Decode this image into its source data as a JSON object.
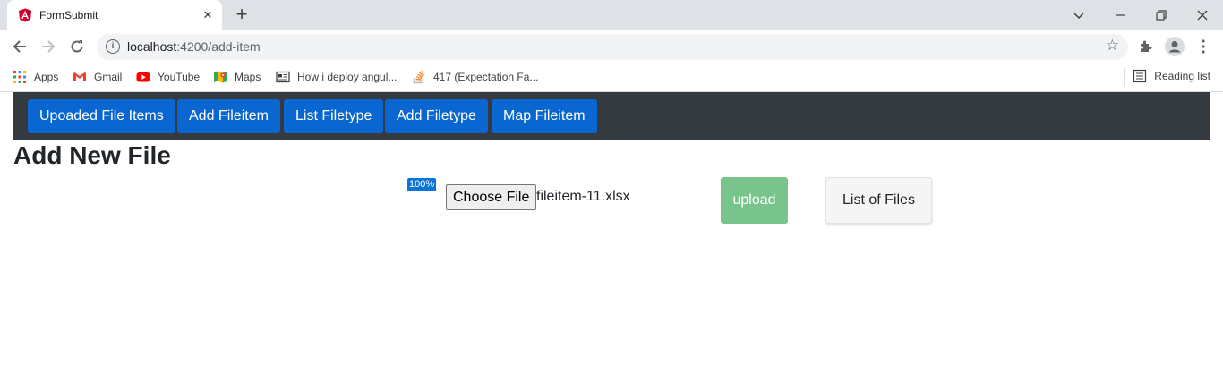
{
  "browser": {
    "tab_title": "FormSubmit",
    "tab_close": "✕",
    "new_tab": "+",
    "url_host": "localhost",
    "url_path": ":4200/add-item",
    "bookmarks": [
      {
        "label": "Apps",
        "icon": "apps-grid-icon"
      },
      {
        "label": "Gmail",
        "icon": "gmail-icon"
      },
      {
        "label": "YouTube",
        "icon": "youtube-icon"
      },
      {
        "label": "Maps",
        "icon": "maps-icon"
      },
      {
        "label": "How i deploy angul...",
        "icon": "page-icon"
      },
      {
        "label": "417 (Expectation Fa...",
        "icon": "stackoverflow-icon"
      }
    ],
    "reading_list": "Reading list"
  },
  "navbar": {
    "items": [
      "Upoaded File Items",
      "Add Fileitem",
      "List Filetype",
      "Add Filetype",
      "Map Fileitem"
    ]
  },
  "page": {
    "heading": "Add New File",
    "progress_label": "100%",
    "progress_value": 100,
    "choose_file_label": "Choose File",
    "file_name": "fileitem-11.xlsx",
    "upload_label": "upload",
    "list_files_label": "List of Files"
  },
  "colors": {
    "nav_bg": "#343a40",
    "nav_button": "#0a66d1",
    "upload_button": "#79c48a",
    "progress_badge": "#0a74d8"
  }
}
